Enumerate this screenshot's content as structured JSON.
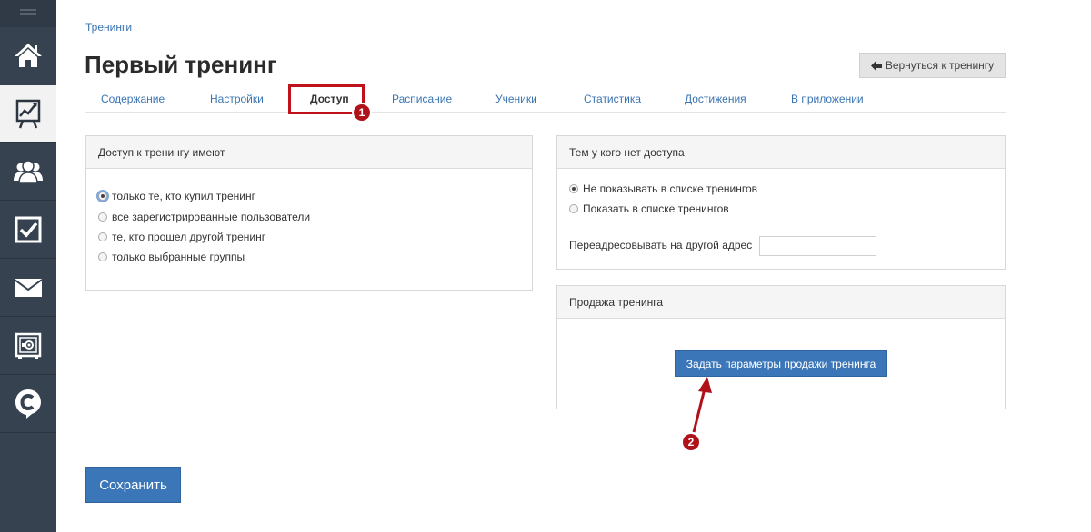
{
  "sidebar": {
    "items": [
      {
        "icon": "home-icon"
      },
      {
        "icon": "training-board-icon",
        "active": true
      },
      {
        "icon": "users-icon"
      },
      {
        "icon": "checkbox-icon"
      },
      {
        "icon": "mail-icon"
      },
      {
        "icon": "safe-icon"
      },
      {
        "icon": "chat-logo-icon"
      }
    ]
  },
  "breadcrumb": "Тренинги",
  "page_title": "Первый тренинг",
  "back_button": {
    "label": "Вернуться к тренингу",
    "icon": "arrow-left-icon"
  },
  "tabs": [
    {
      "label": "Содержание"
    },
    {
      "label": "Настройки"
    },
    {
      "label": "Доступ",
      "active": true
    },
    {
      "label": "Расписание"
    },
    {
      "label": "Ученики"
    },
    {
      "label": "Статистика"
    },
    {
      "label": "Достижения"
    },
    {
      "label": "В приложении"
    }
  ],
  "annotations": {
    "badge1": "1",
    "badge2": "2",
    "accent": "#c0121b"
  },
  "access_panel": {
    "title": "Доступ к тренингу имеют",
    "options": [
      {
        "label": "только те, кто купил тренинг",
        "checked": true
      },
      {
        "label": "все зарегистрированные пользователи",
        "checked": false
      },
      {
        "label": "те, кто прошел другой тренинг",
        "checked": false
      },
      {
        "label": "только выбранные группы",
        "checked": false
      }
    ]
  },
  "no_access_panel": {
    "title": "Тем у кого нет доступа",
    "options": [
      {
        "label": "Не показывать в списке тренингов",
        "checked": true
      },
      {
        "label": "Показать в списке тренингов",
        "checked": false
      }
    ],
    "redirect_label": "Переадресовывать на другой адрес",
    "redirect_value": ""
  },
  "sale_panel": {
    "title": "Продажа тренинга",
    "button_label": "Задать параметры продажи тренинга"
  },
  "save_button": "Сохранить",
  "colors": {
    "sidebar": "#36424f",
    "link": "#3a74b3",
    "primary_button": "#3b76b8"
  }
}
